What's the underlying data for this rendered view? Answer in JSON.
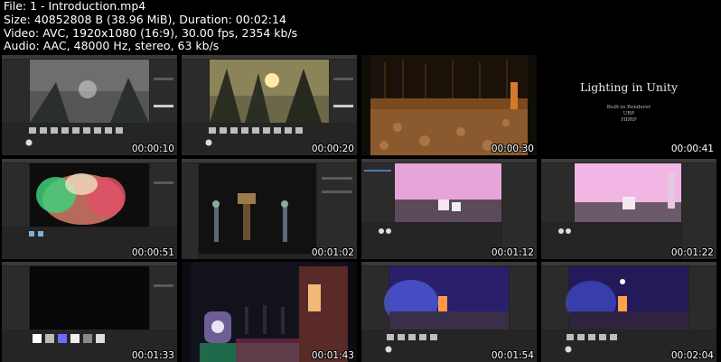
{
  "header": {
    "file": "File: 1 - Introduction.mp4",
    "size": "Size: 40852808 B (38.96 MiB), Duration: 00:02:14",
    "video": "Video: AVC, 1920x1080 (16:9), 30.00 fps, 2354 kb/s",
    "audio": "Audio: AAC, 48000 Hz, stereo, 63 kb/s"
  },
  "thumbnails": [
    {
      "time": "00:00:10",
      "scene": "editor-forest-dark"
    },
    {
      "time": "00:00:20",
      "scene": "editor-forest-sunset"
    },
    {
      "time": "00:00:30",
      "scene": "fullscreen-forest-orange"
    },
    {
      "time": "00:00:41",
      "scene": "title-card"
    },
    {
      "time": "00:00:51",
      "scene": "editor-colored-lights"
    },
    {
      "time": "00:01:02",
      "scene": "editor-statue"
    },
    {
      "time": "00:01:12",
      "scene": "editor-pink-room"
    },
    {
      "time": "00:01:22",
      "scene": "editor-pink-room-2"
    },
    {
      "time": "00:01:33",
      "scene": "editor-dark"
    },
    {
      "time": "00:01:43",
      "scene": "fullscreen-graveyard"
    },
    {
      "time": "00:01:54",
      "scene": "editor-blue-night"
    },
    {
      "time": "00:02:04",
      "scene": "editor-blue-night-2"
    }
  ],
  "title_card": {
    "title": "Lighting in Unity",
    "lines": [
      "Built-in Renderer",
      "URP",
      "HDRP"
    ]
  }
}
